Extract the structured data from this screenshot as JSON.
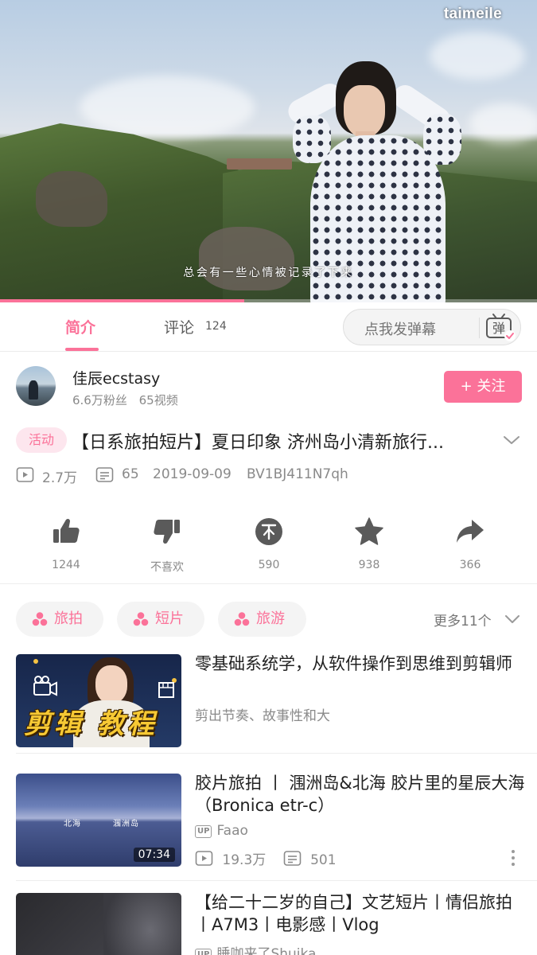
{
  "player": {
    "watermark": "taimeile",
    "subtitle": "总会有一些心情被记录了下来",
    "progress_fraction": 0.455
  },
  "tabs": {
    "intro_label": "简介",
    "comments_label": "评论",
    "comments_count": "124",
    "danmaku_placeholder": "点我发弹幕",
    "danmaku_toggle_glyph": "弹"
  },
  "uploader": {
    "name": "佳辰ecstasy",
    "fans": "6.6万粉丝",
    "videos": "65视频",
    "follow_label": "+ 关注"
  },
  "video": {
    "activity_tag": "活动",
    "title": "【日系旅拍短片】夏日印象  济州岛小清新旅行...",
    "views": "2.7万",
    "danmaku_count": "65",
    "date": "2019-09-09",
    "bvid": "BV1BJ411N7qh"
  },
  "actions": [
    {
      "name": "like",
      "icon": "thumb-up-icon",
      "count": "1244"
    },
    {
      "name": "dislike",
      "icon": "thumb-down-icon",
      "count": "不喜欢"
    },
    {
      "name": "coin",
      "icon": "coin-icon",
      "count": "590"
    },
    {
      "name": "favorite",
      "icon": "star-icon",
      "count": "938"
    },
    {
      "name": "share",
      "icon": "share-icon",
      "count": "366"
    }
  ],
  "tags": [
    "旅拍",
    "短片",
    "旅游"
  ],
  "more_tags": "更多11个",
  "related": [
    {
      "title": "零基础系统学，从软件操作到思维到剪辑师",
      "subtitle": "剪出节奏、故事性和大",
      "thumb_text": "剪辑 教程"
    },
    {
      "title": "胶片旅拍 丨 涠洲岛&北海  胶片里的星辰大海（Bronica  etr-c）",
      "up_badge": "UP",
      "uploader": "Faao",
      "views": "19.3万",
      "danmaku": "501",
      "duration": "07:34",
      "thumb_captions": [
        "北海",
        "涠洲岛"
      ]
    },
    {
      "title": "【给二十二岁的自己】文艺短片丨情侣旅拍丨A7M3丨电影感丨Vlog",
      "up_badge": "UP",
      "uploader": "睡咖来了Shuika"
    }
  ],
  "colors": {
    "accent": "#fb7299",
    "text_primary": "#212121",
    "text_secondary": "#8a8a8a",
    "icon_gray": "#5a5a5a"
  }
}
